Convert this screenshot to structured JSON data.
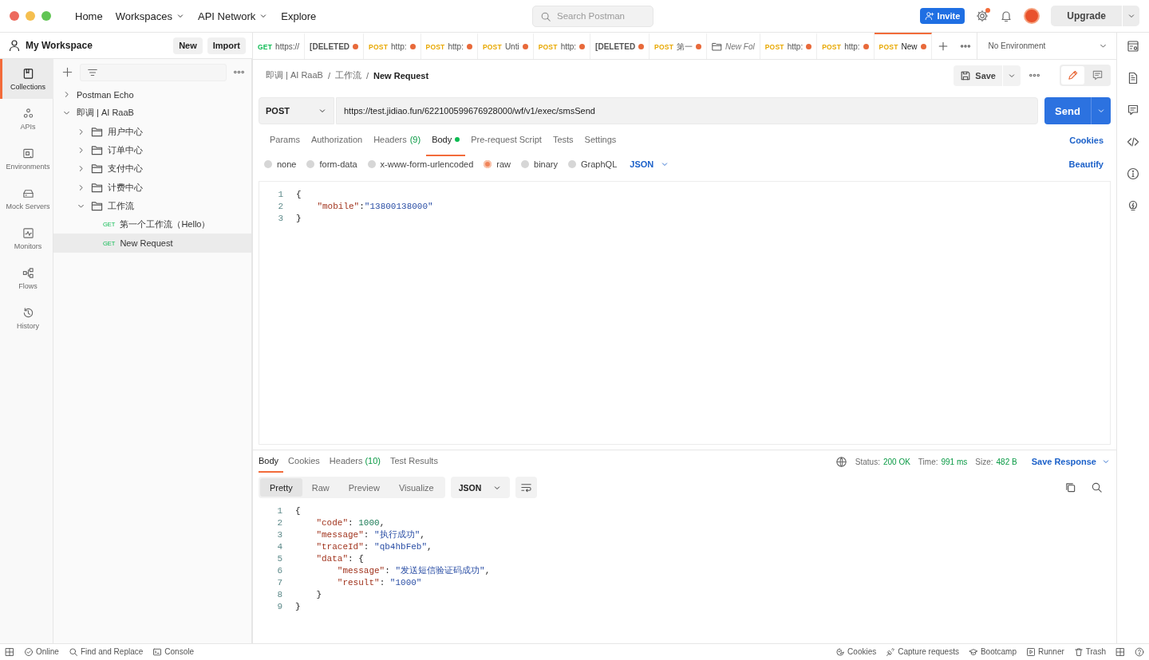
{
  "topbar": {
    "nav": [
      {
        "label": "Home",
        "dropdown": false
      },
      {
        "label": "Workspaces",
        "dropdown": true
      },
      {
        "label": "API Network",
        "dropdown": true
      },
      {
        "label": "Explore",
        "dropdown": false
      }
    ],
    "search": {
      "placeholder": "Search Postman"
    },
    "invite": "Invite",
    "settings_badge": true,
    "upgrade": "Upgrade"
  },
  "workspace": {
    "name": "My Workspace",
    "buttons": [
      "New",
      "Import"
    ]
  },
  "nav_rail": [
    {
      "label": "Collections",
      "selected": true
    },
    {
      "label": "APIs",
      "selected": false
    },
    {
      "label": "Environments",
      "selected": false
    },
    {
      "label": "Mock Servers",
      "selected": false
    },
    {
      "label": "Monitors",
      "selected": false
    },
    {
      "label": "Flows",
      "selected": false
    },
    {
      "label": "History",
      "selected": false
    }
  ],
  "tree": [
    {
      "kind": "collection",
      "label": "Postman Echo",
      "expanded": false,
      "selected": false
    },
    {
      "kind": "collection",
      "label": "即调 | AI RaaB",
      "expanded": true,
      "selected": false,
      "children": [
        {
          "kind": "folder",
          "label": "用户中心",
          "expanded": false,
          "selected": false
        },
        {
          "kind": "folder",
          "label": "订单中心",
          "expanded": false,
          "selected": false
        },
        {
          "kind": "folder",
          "label": "支付中心",
          "expanded": false,
          "selected": false
        },
        {
          "kind": "folder",
          "label": "计费中心",
          "expanded": false,
          "selected": false
        },
        {
          "kind": "folder",
          "label": "工作流",
          "expanded": true,
          "selected": false,
          "children": [
            {
              "kind": "request",
              "method": "GET",
              "label": "第一个工作流（Hello）",
              "selected": false
            },
            {
              "kind": "request",
              "method": "GET",
              "label": "New Request",
              "selected": true
            }
          ]
        }
      ]
    }
  ],
  "tabs": [
    {
      "kind": "request",
      "method": "GET",
      "color": "#0cbb52",
      "title": "https://",
      "unsaved": false,
      "selected": false
    },
    {
      "kind": "deleted",
      "title": "[DELETED",
      "unsaved": true,
      "selected": false
    },
    {
      "kind": "request",
      "method": "POST",
      "color": "#e8a800",
      "title": "http:",
      "unsaved": true,
      "selected": false
    },
    {
      "kind": "request",
      "method": "POST",
      "color": "#e8a800",
      "title": "http:",
      "unsaved": true,
      "selected": false
    },
    {
      "kind": "request",
      "method": "POST",
      "color": "#e8a800",
      "title": "Unti",
      "unsaved": true,
      "selected": false
    },
    {
      "kind": "request",
      "method": "POST",
      "color": "#e8a800",
      "title": "http:",
      "unsaved": true,
      "selected": false
    },
    {
      "kind": "deleted",
      "title": "[DELETED",
      "unsaved": true,
      "selected": false
    },
    {
      "kind": "request",
      "method": "POST",
      "color": "#e8a800",
      "title": "第一",
      "unsaved": true,
      "selected": false
    },
    {
      "kind": "folder",
      "title": "New Fol",
      "unsaved": false,
      "selected": false
    },
    {
      "kind": "request",
      "method": "POST",
      "color": "#e8a800",
      "title": "http:",
      "unsaved": true,
      "selected": false
    },
    {
      "kind": "request",
      "method": "POST",
      "color": "#e8a800",
      "title": "http:",
      "unsaved": true,
      "selected": false
    },
    {
      "kind": "request",
      "method": "POST",
      "color": "#e8a800",
      "title": "New",
      "unsaved": true,
      "selected": true
    }
  ],
  "environment": "No Environment",
  "breadcrumb": [
    "即调 | AI RaaB",
    "/",
    "工作流",
    "/",
    "New Request"
  ],
  "save": "Save",
  "request": {
    "method": "POST",
    "url": "https://test.jidiao.fun/622100599676928000/wf/v1/exec/smsSend",
    "send": "Send",
    "tabs": [
      {
        "label": "Params",
        "dot": false,
        "selected": false
      },
      {
        "label": "Authorization",
        "dot": false,
        "selected": false
      },
      {
        "label": "Headers",
        "count": "(9)",
        "dot": false,
        "selected": false
      },
      {
        "label": "Body",
        "dot": true,
        "selected": true
      },
      {
        "label": "Pre-request Script",
        "dot": false,
        "selected": false
      },
      {
        "label": "Tests",
        "dot": false,
        "selected": false
      },
      {
        "label": "Settings",
        "dot": false,
        "selected": false
      }
    ],
    "cookies": "Cookies",
    "body_types": [
      {
        "label": "none",
        "selected": false
      },
      {
        "label": "form-data",
        "selected": false
      },
      {
        "label": "x-www-form-urlencoded",
        "selected": false
      },
      {
        "label": "raw",
        "selected": true
      },
      {
        "label": "binary",
        "selected": false
      },
      {
        "label": "GraphQL",
        "selected": false
      }
    ],
    "language": "JSON",
    "beautify": "Beautify",
    "lines": [
      {
        "number": "1",
        "tokens": [
          {
            "kind": "punct",
            "text": "{"
          }
        ]
      },
      {
        "number": "2",
        "tokens": [
          {
            "kind": "key",
            "text": "    \"mobile\""
          },
          {
            "kind": "punct",
            "text": ":"
          },
          {
            "kind": "string",
            "text": "\"13800138000\""
          }
        ]
      },
      {
        "number": "3",
        "tokens": [
          {
            "kind": "punct",
            "text": "}"
          }
        ]
      }
    ]
  },
  "response": {
    "tabs": [
      {
        "label": "Body",
        "selected": true
      },
      {
        "label": "Cookies",
        "selected": false
      },
      {
        "label": "Headers",
        "count": "(10)",
        "selected": false
      },
      {
        "label": "Test Results",
        "selected": false
      }
    ],
    "stats": [
      {
        "label": "Status:",
        "value": "200 OK"
      },
      {
        "label": "Time:",
        "value": "991 ms"
      },
      {
        "label": "Size:",
        "value": "482 B"
      }
    ],
    "save": "Save Response",
    "views": [
      {
        "label": "Pretty",
        "selected": true
      },
      {
        "label": "Raw",
        "selected": false
      },
      {
        "label": "Preview",
        "selected": false
      },
      {
        "label": "Visualize",
        "selected": false
      }
    ],
    "language": "JSON",
    "lines": [
      {
        "number": "1",
        "tokens": [
          {
            "kind": "punct",
            "text": "{"
          }
        ]
      },
      {
        "number": "2",
        "tokens": [
          {
            "kind": "key",
            "text": "    \"code\""
          },
          {
            "kind": "punct",
            "text": ": "
          },
          {
            "kind": "number",
            "text": "1000"
          },
          {
            "kind": "punct",
            "text": ","
          }
        ]
      },
      {
        "number": "3",
        "tokens": [
          {
            "kind": "key",
            "text": "    \"message\""
          },
          {
            "kind": "punct",
            "text": ": "
          },
          {
            "kind": "string",
            "text": "\"执行成功\""
          },
          {
            "kind": "punct",
            "text": ","
          }
        ]
      },
      {
        "number": "4",
        "tokens": [
          {
            "kind": "key",
            "text": "    \"traceId\""
          },
          {
            "kind": "punct",
            "text": ": "
          },
          {
            "kind": "string",
            "text": "\"qb4hbFeb\""
          },
          {
            "kind": "punct",
            "text": ","
          }
        ]
      },
      {
        "number": "5",
        "tokens": [
          {
            "kind": "key",
            "text": "    \"data\""
          },
          {
            "kind": "punct",
            "text": ": {"
          }
        ]
      },
      {
        "number": "6",
        "tokens": [
          {
            "kind": "key",
            "text": "        \"message\""
          },
          {
            "kind": "punct",
            "text": ": "
          },
          {
            "kind": "string",
            "text": "\"发送短信验证码成功\""
          },
          {
            "kind": "punct",
            "text": ","
          }
        ]
      },
      {
        "number": "7",
        "tokens": [
          {
            "kind": "key",
            "text": "        \"result\""
          },
          {
            "kind": "punct",
            "text": ": "
          },
          {
            "kind": "string",
            "text": "\"1000\""
          }
        ]
      },
      {
        "number": "8",
        "tokens": [
          {
            "kind": "punct",
            "text": "    }"
          }
        ]
      },
      {
        "number": "9",
        "tokens": [
          {
            "kind": "punct",
            "text": "}"
          }
        ]
      }
    ]
  },
  "status_bar": {
    "left": [
      "Online",
      "Find and Replace",
      "Console"
    ],
    "right": [
      "Cookies",
      "Capture requests",
      "Bootcamp",
      "Runner",
      "Trash"
    ]
  }
}
